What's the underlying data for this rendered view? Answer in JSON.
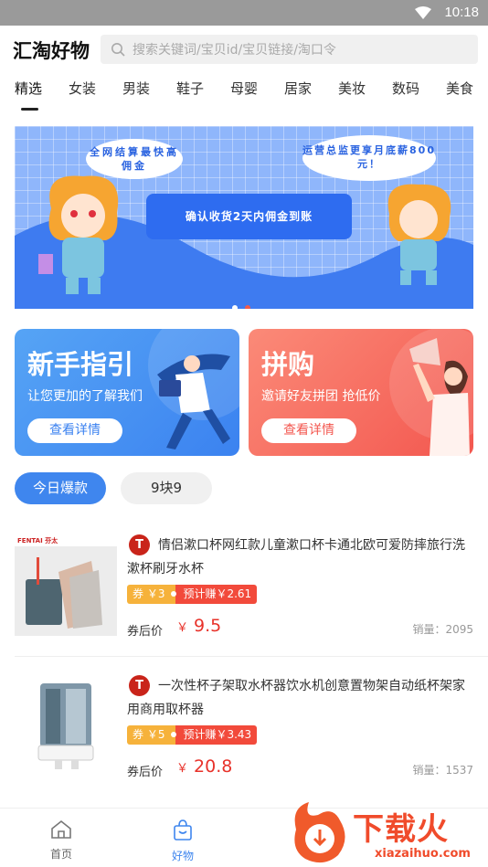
{
  "status": {
    "time": "10:18"
  },
  "header": {
    "logo": "汇淘好物",
    "search_placeholder": "搜索关键词/宝贝id/宝贝链接/淘口令"
  },
  "categories": [
    "精选",
    "女装",
    "男装",
    "鞋子",
    "母婴",
    "居家",
    "美妆",
    "数码",
    "美食"
  ],
  "banner": {
    "bubble_left": "全网结算最快高佣金",
    "bubble_right": "运营总监更享月底薪800元！",
    "pill": "确认收货2天内佣金到账"
  },
  "cards": [
    {
      "title": "新手指引",
      "subtitle": "让您更加的了解我们",
      "button": "查看详情"
    },
    {
      "title": "拼购",
      "subtitle": "邀请好友拼团 抢低价",
      "button": "查看详情"
    }
  ],
  "tabs": [
    "今日爆款",
    "9块9"
  ],
  "products": [
    {
      "badge": "T",
      "title": "情侣漱口杯网红款儿童漱口杯卡通北欧可爱防摔旅行洗漱杯刷牙水杯",
      "coupon": "券 ￥3",
      "earn": "预计赚￥2.61",
      "after_label": "券后价",
      "currency": "￥",
      "price": "9.5",
      "sales": "销量：2095"
    },
    {
      "badge": "T",
      "title": "一次性杯子架取水杯器饮水机创意置物架自动纸杯架家用商用取杯器",
      "coupon": "券 ￥5",
      "earn": "预计赚￥3.43",
      "after_label": "券后价",
      "currency": "￥",
      "price": "20.8",
      "sales": "销量：1537"
    }
  ],
  "bottom_nav": [
    {
      "label": "首页",
      "icon": "home-icon"
    },
    {
      "label": "好物",
      "icon": "shopping-bag-icon"
    }
  ],
  "watermark": {
    "brand": "下载火",
    "url": "xiazaihuo.com"
  },
  "colors": {
    "accent_blue": "#3f86ee",
    "price_red": "#e8322a",
    "coupon_orange": "#f6b23b",
    "earn_red": "#f24a3b"
  }
}
